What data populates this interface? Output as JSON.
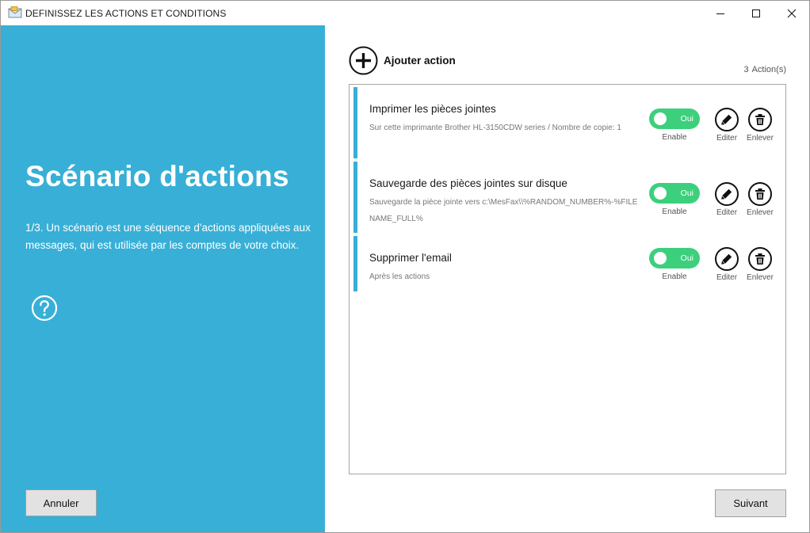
{
  "window": {
    "title": "DEFINISSEZ LES ACTIONS ET CONDITIONS",
    "icons": {
      "app": "envelope-app-icon",
      "minimize": "minimize-icon",
      "maximize": "maximize-icon",
      "close": "close-icon"
    }
  },
  "left_panel": {
    "background": "#38afd6",
    "title": "Scénario d'actions",
    "description": "1/3. Un scénario est une séquence d'actions appliquées aux messages, qui est utilisée par les comptes de votre choix.",
    "help_icon": "question-circle-icon",
    "cancel_label": "Annuler"
  },
  "main": {
    "add_action_label": "Ajouter action",
    "action_count": "3",
    "action_count_unit": "Action(s)",
    "toggle_color": "#3cd07c",
    "actions": [
      {
        "title": "Imprimer les pièces jointes",
        "subtitle": "Sur cette imprimante Brother HL-3150CDW series / Nombre de copie: 1",
        "toggle_label": "Oui",
        "enabled": true,
        "enable_label": "Enable",
        "edit_label": "Editer",
        "remove_label": "Enlever"
      },
      {
        "title": "Sauvegarde des pièces jointes sur disque",
        "subtitle": "Sauvegarde la pièce jointe vers c:\\MesFax\\\\%RANDOM_NUMBER%-%FILENAME_FULL%",
        "toggle_label": "Oui",
        "enabled": true,
        "enable_label": "Enable",
        "edit_label": "Editer",
        "remove_label": "Enlever"
      },
      {
        "title": "Supprimer l'email",
        "subtitle": "Après les actions",
        "toggle_label": "Oui",
        "enabled": true,
        "enable_label": "Enable",
        "edit_label": "Editer",
        "remove_label": "Enlever"
      }
    ],
    "next_label": "Suivant"
  }
}
